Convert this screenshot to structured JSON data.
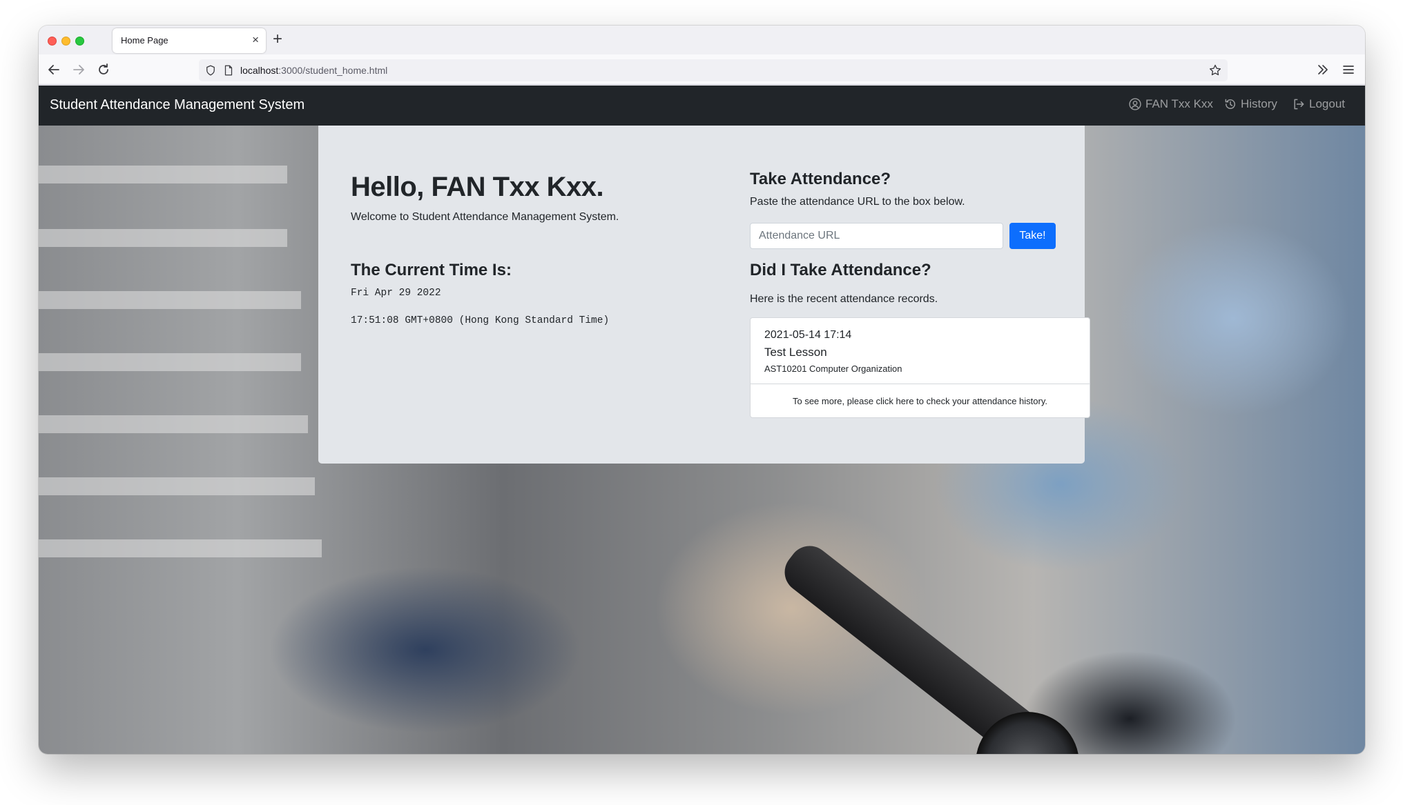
{
  "browser": {
    "tab_title": "Home Page",
    "tab_close": "×",
    "new_tab": "+",
    "url_host": "localhost",
    "url_path": ":3000/student_home.html"
  },
  "navbar": {
    "brand": "Student Attendance Management System",
    "user_label": "FAN Txx Kxx",
    "history_label": "History",
    "logout_label": "Logout"
  },
  "greeting": {
    "title": "Hello, FAN Txx Kxx.",
    "welcome": "Welcome to Student Attendance Management System."
  },
  "current_time": {
    "heading": "The Current Time Is:",
    "date": "Fri Apr 29 2022",
    "time": "17:51:08 GMT+0800 (Hong Kong Standard Time)"
  },
  "take_attendance": {
    "heading": "Take Attendance?",
    "subtext": "Paste the attendance URL to the box below.",
    "input_placeholder": "Attendance URL",
    "button_label": "Take!"
  },
  "records": {
    "heading": "Did I Take Attendance?",
    "subtext": "Here is the recent attendance records.",
    "items": [
      {
        "datetime": "2021-05-14 17:14",
        "lesson": "Test Lesson",
        "course": "AST10201 Computer Organization"
      }
    ],
    "footer": "To see more, please click here to check your attendance history."
  },
  "colors": {
    "navbar_bg": "#212529",
    "primary": "#0d6efd",
    "card_bg": "#e3e6ea"
  }
}
